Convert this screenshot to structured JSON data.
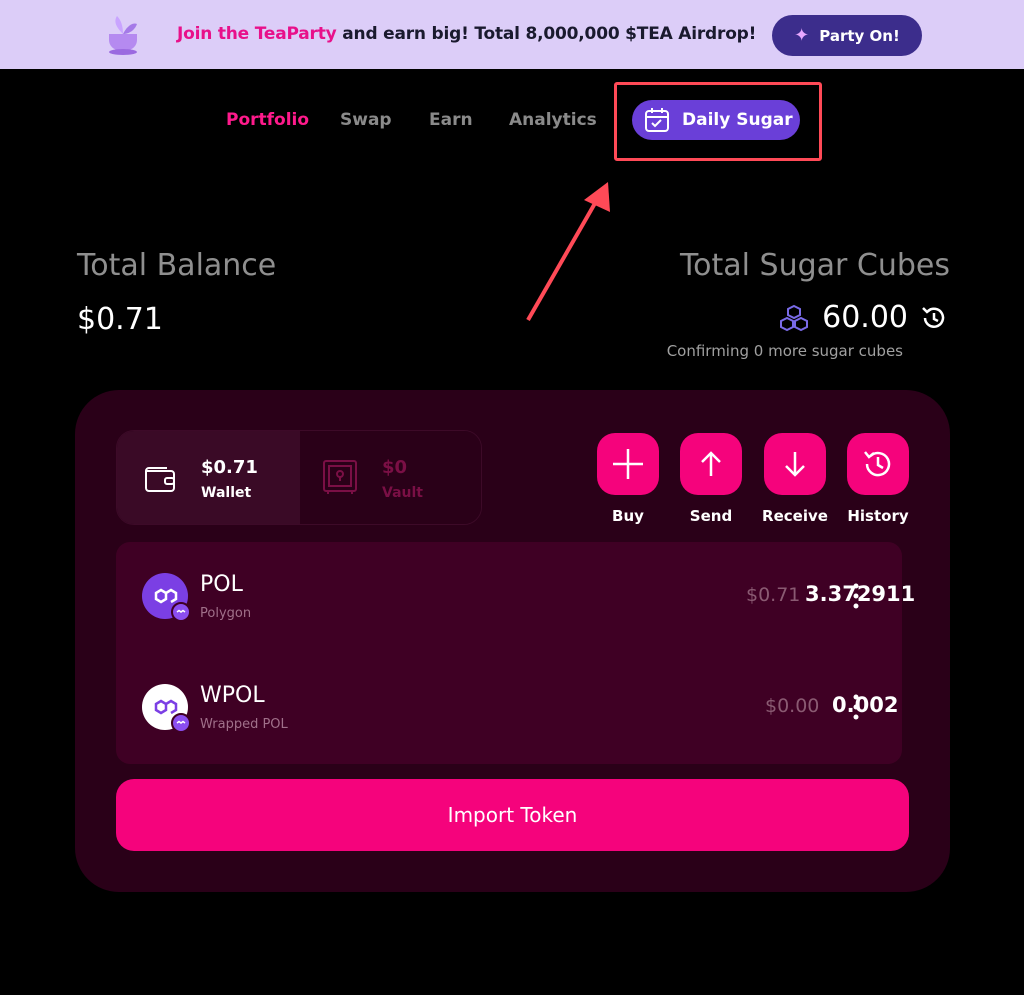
{
  "banner": {
    "text_prefix": "Join the TeaParty",
    "text_rest": " and earn big! Total 8,000,000 $TEA Airdrop!",
    "button_label": "Party On!"
  },
  "nav": {
    "items": [
      {
        "label": "Portfolio",
        "active": true
      },
      {
        "label": "Swap",
        "active": false
      },
      {
        "label": "Earn",
        "active": false
      },
      {
        "label": "Analytics",
        "active": false
      }
    ],
    "daily_sugar_label": "Daily Sugar"
  },
  "balance": {
    "label": "Total Balance",
    "value": "$0.71"
  },
  "sugar": {
    "label": "Total Sugar Cubes",
    "value": "60.00",
    "confirming": "Confirming 0 more sugar cubes"
  },
  "wallet": {
    "wallet_amount": "$0.71",
    "wallet_label": "Wallet",
    "vault_amount": "$0",
    "vault_label": "Vault"
  },
  "actions": [
    {
      "label": "Buy",
      "icon": "plus-icon"
    },
    {
      "label": "Send",
      "icon": "arrow-up-icon"
    },
    {
      "label": "Receive",
      "icon": "arrow-down-icon"
    },
    {
      "label": "History",
      "icon": "history-icon"
    }
  ],
  "tokens": [
    {
      "name": "POL",
      "network": "Polygon",
      "usd": "$0.71",
      "amount": "3.372911"
    },
    {
      "name": "WPOL",
      "network": "Wrapped POL",
      "usd": "$0.00",
      "amount": "0.002"
    }
  ],
  "import_label": "Import Token",
  "colors": {
    "accent": "#f5037c",
    "nav_active": "#ff1a8c",
    "daily_button": "#6a3fd8",
    "banner_bg": "#dccdf8",
    "highlight": "#ff4a57"
  }
}
